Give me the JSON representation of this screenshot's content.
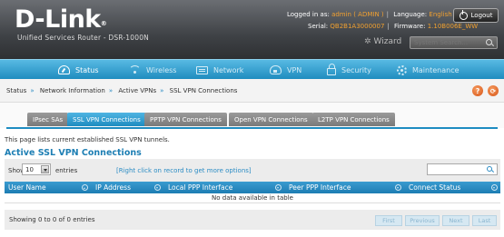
{
  "brand": {
    "logo": "D-Link",
    "product": "Unified Services Router - DSR-1000N"
  },
  "header": {
    "logged_in_label": "Logged in as:",
    "logged_in_value": "admin ( ADMIN )",
    "language_label": "Language:",
    "language_value": "English [US]",
    "serial_label": "Serial:",
    "serial_value": "QB2B1A3000007",
    "firmware_label": "Firmware:",
    "firmware_value": "1.10B006E_WW",
    "logout_label": "Logout",
    "wizard_label": "Wizard",
    "search_placeholder": "System Search..."
  },
  "nav": {
    "items": [
      {
        "label": "Status",
        "active": true
      },
      {
        "label": "Wireless"
      },
      {
        "label": "Network"
      },
      {
        "label": "VPN"
      },
      {
        "label": "Security"
      },
      {
        "label": "Maintenance"
      }
    ]
  },
  "breadcrumb": [
    "Status",
    "Network Information",
    "Active VPNs",
    "SSL VPN Connections"
  ],
  "tabs": [
    {
      "label": "IPsec SAs"
    },
    {
      "label": "SSL VPN Connections",
      "active": true
    },
    {
      "label": "PPTP VPN Connections"
    },
    {
      "label": "Open VPN Connections"
    },
    {
      "label": "L2TP VPN Connections"
    }
  ],
  "page": {
    "description": "This page lists current established SSL VPN tunnels.",
    "section_title": "Active SSL VPN Connections"
  },
  "table": {
    "show_label": "Show",
    "page_size": "10",
    "entries_label": "entries",
    "hint": "[Right click on record to get more options]",
    "columns": [
      "User Name",
      "IP Address",
      "Local PPP Interface",
      "Peer PPP Interface",
      "Connect Status"
    ],
    "empty_text": "No data available in table",
    "info": "Showing 0 to 0 of 0 entries",
    "pager": {
      "first": "First",
      "previous": "Previous",
      "next": "Next",
      "last": "Last"
    }
  },
  "colors": {
    "accent": "#1e8cc1",
    "orange": "#e0651f",
    "header_dark": "#3f4246"
  }
}
